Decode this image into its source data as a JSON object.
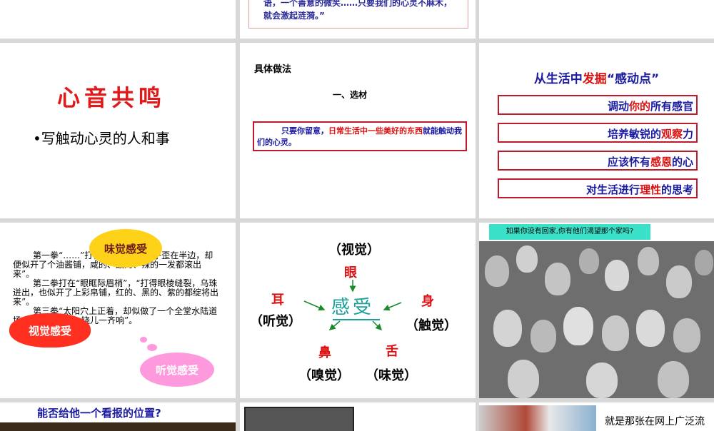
{
  "row0": {
    "middle_quote": "语，一个善意的微笑……只要我们的心灵不麻木，就会激起涟漪。”"
  },
  "slide_xinyin": {
    "title": "心音共鸣",
    "bullet": "•写触动心灵的人和事"
  },
  "slide_method": {
    "heading": "具体做法",
    "subheading": "一、选材",
    "text_a": "只要你留意，",
    "text_b": "日常生活中一些美好的东西",
    "text_c": "就能触动我们的心灵。"
  },
  "slide_life": {
    "title_a": "从生活中",
    "title_b": "发掘",
    "title_c": "“感动点”",
    "items": [
      {
        "a": "调动",
        "b": "你的",
        "c": "所有感官"
      },
      {
        "a": "培养敏锐的",
        "b": "观察",
        "c": "力"
      },
      {
        "a": "应该怀有",
        "b": "感恩",
        "c": "的心"
      },
      {
        "a": "对生活进行",
        "b": "理性",
        "c": "的思考"
      }
    ]
  },
  "slide_senses_text": {
    "paragraphs": [
      "第一拳“……”打得鲜血迸流，鼻子歪在半边，却便似开了个油酱铺，咸的、酸的、辣的一发都滚出来”。",
      "第二拳打在“眼眶际眉梢”，“打得眼棱缝裂，乌珠迸出，也似开了上彩帛铺，红的、黑的、紫的都绽将出来”。",
      "第三拳“太阳穴上正着，却似做了一个全堂水陆道场，磬儿、钹儿、铙儿一齐响”。"
    ],
    "bubble_taste": "味觉感受",
    "bubble_sight": "视觉感受",
    "bubble_hearing": "听觉感受"
  },
  "slide_senses_diagram": {
    "center": "感受",
    "eye": "眼",
    "eye_sense": "（视觉）",
    "ear": "耳",
    "ear_sense": "（听觉）",
    "body": "身",
    "body_sense": "（触觉）",
    "nose": "鼻",
    "nose_sense": "（嗅觉）",
    "tongue": "舌",
    "tongue_sense": "（味觉）"
  },
  "slide_crowd": {
    "banner": "如果你没有回家,你有他们渴望那个家吗?"
  },
  "row3": {
    "newspaper_question": "能否给他一个看报的位置?",
    "web_text": "就是那张在网上广泛流"
  },
  "colors": {
    "red": "#e01a1a",
    "blue": "#1a1aa0",
    "border_red": "#c01a2a",
    "teal": "#1aa09a"
  }
}
